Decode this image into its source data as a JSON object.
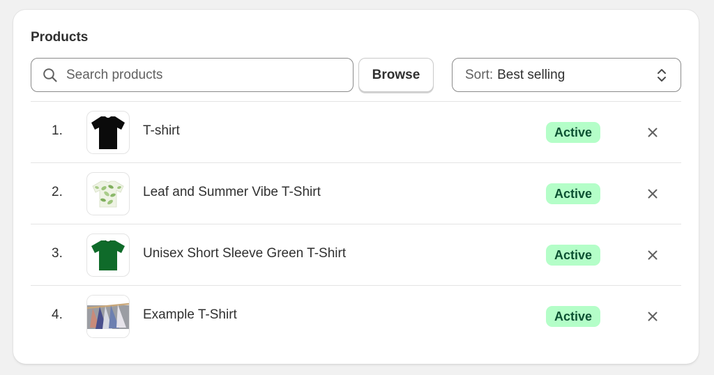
{
  "panel": {
    "title": "Products"
  },
  "search": {
    "placeholder": "Search products",
    "value": ""
  },
  "browse_label": "Browse",
  "sort": {
    "label": "Sort:",
    "value": "Best selling"
  },
  "products": [
    {
      "index": "1.",
      "name": "T-shirt",
      "status": "Active",
      "thumb": "black-tshirt-image"
    },
    {
      "index": "2.",
      "name": "Leaf and Summer Vibe T-Shirt",
      "status": "Active",
      "thumb": "leaf-tshirt-image"
    },
    {
      "index": "3.",
      "name": "Unisex Short Sleeve Green T-Shirt",
      "status": "Active",
      "thumb": "green-tshirt-image"
    },
    {
      "index": "4.",
      "name": "Example T-Shirt",
      "status": "Active",
      "thumb": "hanging-shirts-image"
    }
  ],
  "icons": {
    "search": "search-icon",
    "sort": "chevron-up-down-icon",
    "remove": "close-icon"
  },
  "colors": {
    "badge_bg": "#b4fec8",
    "badge_text": "#0c5132",
    "text": "#303030",
    "muted": "#616161"
  }
}
